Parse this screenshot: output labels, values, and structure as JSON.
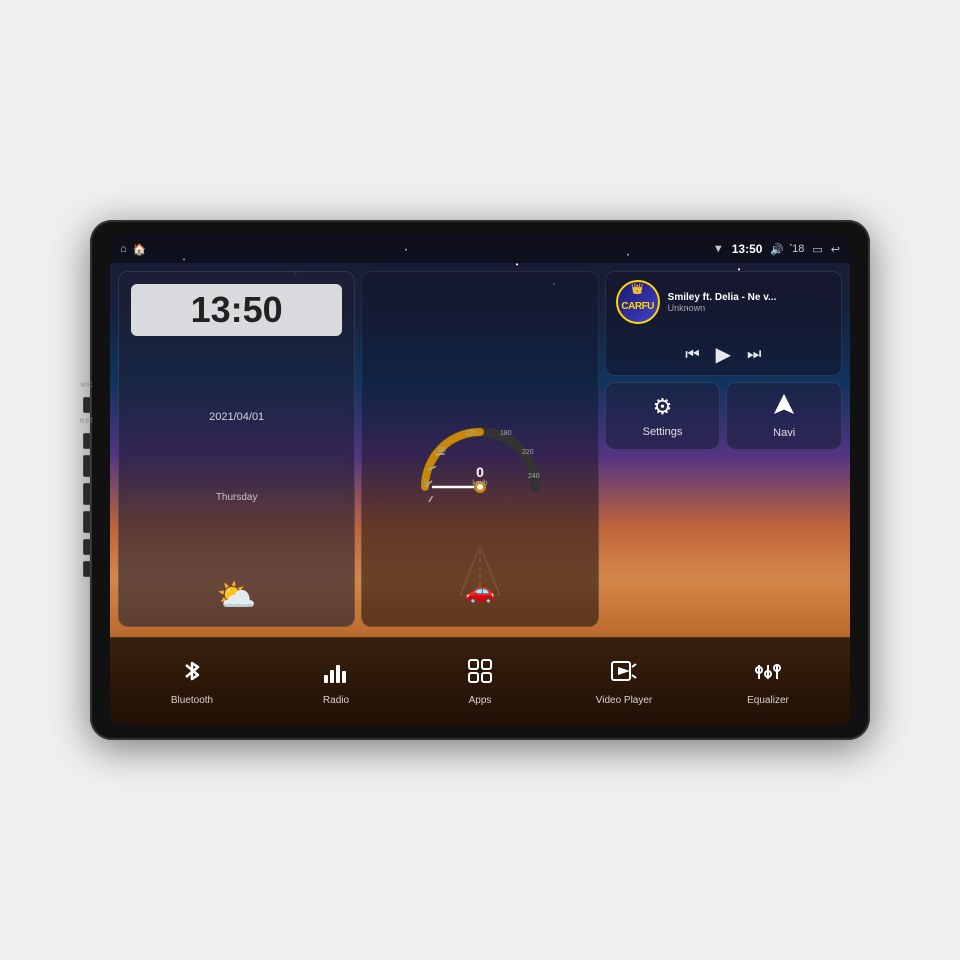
{
  "device": {
    "title": "Car Head Unit"
  },
  "statusBar": {
    "leftIcons": [
      "⌂",
      "🏠"
    ],
    "time": "13:50",
    "volume": "🔊",
    "volumeLevel": "18",
    "battery": "🔋",
    "back": "↩"
  },
  "clock": {
    "hour": "13",
    "minute": "50",
    "date": "2021/04/01",
    "day": "Thursday",
    "weatherIcon": "⛅"
  },
  "speedometer": {
    "speed": "0",
    "unit": "km/h"
  },
  "music": {
    "logoText": "CARFU",
    "title": "Smiley ft. Delia - Ne v...",
    "artist": "Unknown"
  },
  "settings": {
    "label": "Settings",
    "icon": "⚙"
  },
  "navi": {
    "label": "Navi",
    "icon": "▲"
  },
  "dock": [
    {
      "id": "bluetooth",
      "label": "Bluetooth",
      "icon": "bluetooth"
    },
    {
      "id": "radio",
      "label": "Radio",
      "icon": "radio"
    },
    {
      "id": "apps",
      "label": "Apps",
      "icon": "apps"
    },
    {
      "id": "video-player",
      "label": "Video Player",
      "icon": "video"
    },
    {
      "id": "equalizer",
      "label": "Equalizer",
      "icon": "eq"
    }
  ],
  "sideButtons": [
    {
      "id": "mic",
      "label": "MIC"
    },
    {
      "id": "rst",
      "label": "RST"
    },
    {
      "id": "power",
      "label": ""
    },
    {
      "id": "home-side",
      "label": ""
    },
    {
      "id": "back-side",
      "label": ""
    },
    {
      "id": "vol-up",
      "label": ""
    },
    {
      "id": "vol-down",
      "label": ""
    }
  ]
}
